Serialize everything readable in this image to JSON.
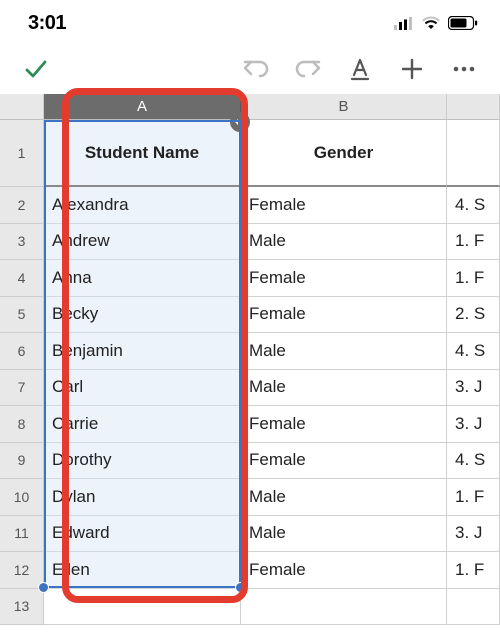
{
  "status": {
    "time": "3:01"
  },
  "toolbar": {},
  "columns": [
    "A",
    "B",
    ""
  ],
  "header_row": {
    "a": "Student Name",
    "b": "Gender",
    "c": ""
  },
  "rows": [
    {
      "n": "2",
      "a": "Alexandra",
      "b": "Female",
      "c": "4. S"
    },
    {
      "n": "3",
      "a": "Andrew",
      "b": "Male",
      "c": "1. F"
    },
    {
      "n": "4",
      "a": "Anna",
      "b": "Female",
      "c": "1. F"
    },
    {
      "n": "5",
      "a": "Becky",
      "b": "Female",
      "c": "2. S"
    },
    {
      "n": "6",
      "a": "Benjamin",
      "b": "Male",
      "c": "4. S"
    },
    {
      "n": "7",
      "a": "Carl",
      "b": "Male",
      "c": "3. J"
    },
    {
      "n": "8",
      "a": "Carrie",
      "b": "Female",
      "c": "3. J"
    },
    {
      "n": "9",
      "a": "Dorothy",
      "b": "Female",
      "c": "4. S"
    },
    {
      "n": "10",
      "a": "Dylan",
      "b": "Male",
      "c": "1. F"
    },
    {
      "n": "11",
      "a": "Edward",
      "b": "Male",
      "c": "3. J"
    },
    {
      "n": "12",
      "a": "Ellen",
      "b": "Female",
      "c": "1. F"
    },
    {
      "n": "13",
      "a": "",
      "b": "",
      "c": ""
    }
  ]
}
